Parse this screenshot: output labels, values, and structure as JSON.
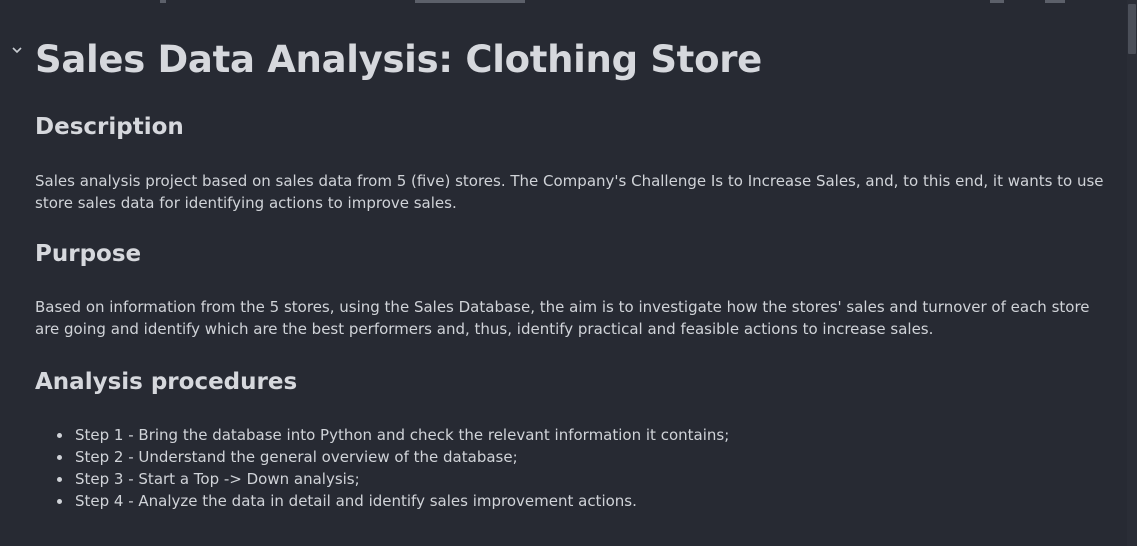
{
  "page": {
    "title": "Sales Data Analysis: Clothing Store"
  },
  "sections": {
    "description": {
      "heading": "Description",
      "text": "Sales analysis project based on sales data from 5 (five) stores. The Company's Challenge Is to Increase Sales, and, to this end, it wants to use store sales data for identifying actions to improve sales."
    },
    "purpose": {
      "heading": "Purpose",
      "text": "Based on information from the 5 stores, using the Sales Database, the aim is to investigate how the stores' sales and turnover of each store are going and identify which are the best performers and, thus, identify practical and feasible actions to increase sales."
    },
    "procedures": {
      "heading": "Analysis procedures",
      "steps": [
        "Step 1 - Bring the database into Python and check the relevant information it contains;",
        "Step 2 - Understand the general overview of the database;",
        "Step 3 - Start a Top -> Down analysis;",
        "Step 4 - Analyze the data in detail and identify sales improvement actions."
      ]
    }
  },
  "icons": {
    "collapse": "chevron-down-icon"
  },
  "colors": {
    "background": "#272a33",
    "text": "#d0d3d8",
    "heading": "#d6d8dd"
  }
}
